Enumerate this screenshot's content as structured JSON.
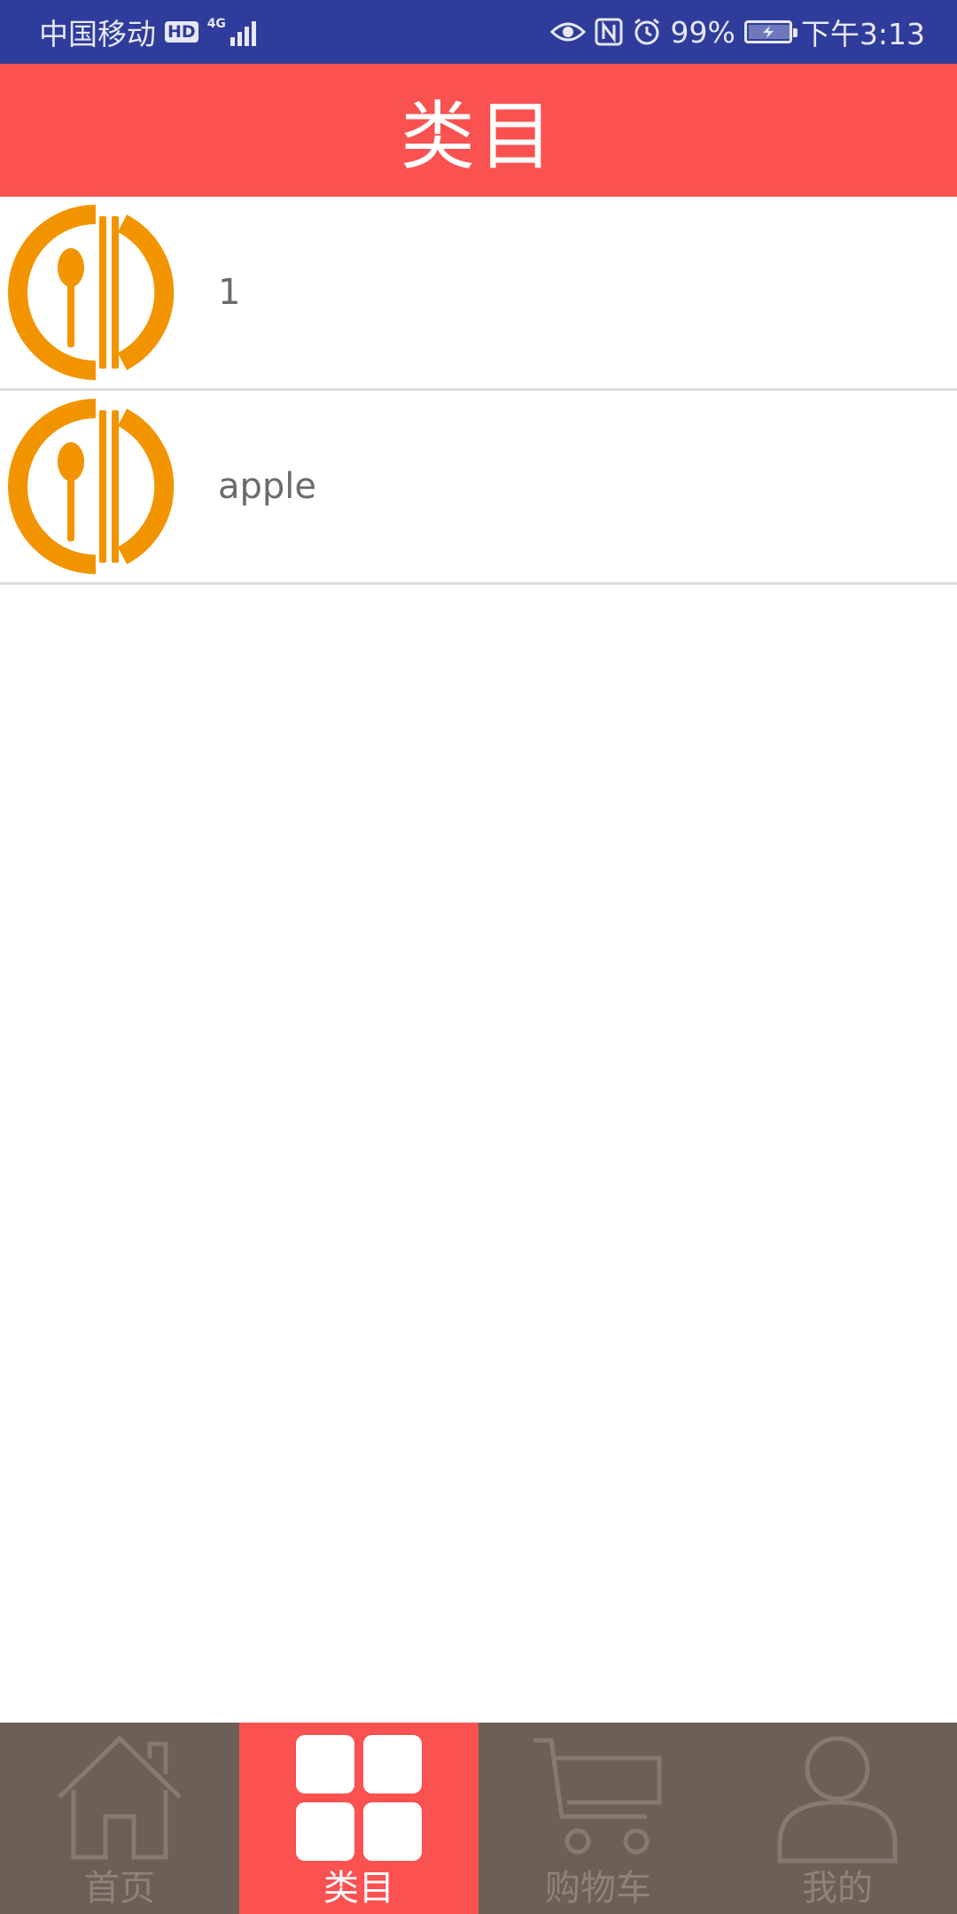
{
  "status_bar": {
    "carrier": "中国移动",
    "hd": "HD",
    "network": "4G",
    "battery": "99%",
    "battery_level": 0.99,
    "time": "下午3:13",
    "icons": [
      "eye-icon",
      "nfc-icon",
      "alarm-icon",
      "battery-icon"
    ]
  },
  "header": {
    "title": "类目"
  },
  "list": {
    "items": [
      {
        "label": "1",
        "icon": "restaurant-icon"
      },
      {
        "label": "apple",
        "icon": "restaurant-icon"
      }
    ]
  },
  "nav": {
    "tabs": [
      {
        "label": "首页",
        "icon": "home-icon",
        "active": false
      },
      {
        "label": "类目",
        "icon": "grid-icon",
        "active": true
      },
      {
        "label": "购物车",
        "icon": "cart-icon",
        "active": false
      },
      {
        "label": "我的",
        "icon": "user-icon",
        "active": false
      }
    ]
  },
  "colors": {
    "status_bar": "#2f3c9b",
    "accent": "#fa5151",
    "nav_bg": "#6b5f56",
    "icon_orange": "#f29400"
  }
}
